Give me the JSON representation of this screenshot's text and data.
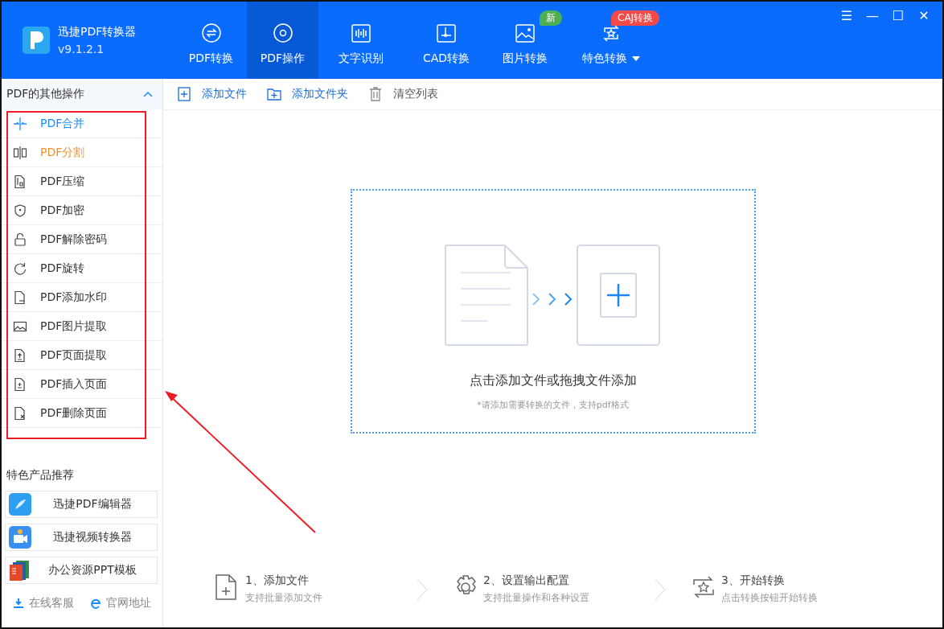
{
  "app": {
    "name": "迅捷PDF转换器",
    "version": "v9.1.2.1"
  },
  "tabs": [
    {
      "label": "PDF转换",
      "selected": false
    },
    {
      "label": "PDF操作",
      "selected": true
    },
    {
      "label": "文字识别",
      "selected": false
    },
    {
      "label": "CAD转换",
      "selected": false
    },
    {
      "label": "图片转换",
      "selected": false,
      "badge": {
        "text": "新",
        "color": "#4caf50"
      }
    },
    {
      "label": "特色转换",
      "selected": false,
      "dropdown": true,
      "badge": {
        "text": "CAJ转换",
        "color": "#f44a4a"
      }
    }
  ],
  "window_controls": [
    "☰",
    "—",
    "☐",
    "✕"
  ],
  "sidebar": {
    "title": "PDF的其他操作",
    "expanded": true,
    "items": [
      {
        "label": "PDF合并",
        "selected": true,
        "hovered": false
      },
      {
        "label": "PDF分割",
        "selected": false,
        "hovered": true
      },
      {
        "label": "PDF压缩",
        "selected": false,
        "hovered": false
      },
      {
        "label": "PDF加密",
        "selected": false,
        "hovered": false
      },
      {
        "label": "PDF解除密码",
        "selected": false,
        "hovered": false
      },
      {
        "label": "PDF旋转",
        "selected": false,
        "hovered": false
      },
      {
        "label": "PDF添加水印",
        "selected": false,
        "hovered": false
      },
      {
        "label": "PDF图片提取",
        "selected": false,
        "hovered": false
      },
      {
        "label": "PDF页面提取",
        "selected": false,
        "hovered": false
      },
      {
        "label": "PDF插入页面",
        "selected": false,
        "hovered": false
      },
      {
        "label": "PDF删除页面",
        "selected": false,
        "hovered": false
      }
    ],
    "recommend_title": "特色产品推荐",
    "products": [
      "迅捷PDF编辑器",
      "迅捷视频转换器",
      "办公资源PPT模板"
    ],
    "links": [
      "在线客服",
      "官网地址"
    ]
  },
  "toolbar": [
    "添加文件",
    "添加文件夹",
    "清空列表"
  ],
  "dropzone": {
    "title": "点击添加文件或拖拽文件添加",
    "hint": "*请添加需要转换的文件，支持pdf格式"
  },
  "steps": [
    {
      "title": "1、添加文件",
      "desc": "支持批量添加文件"
    },
    {
      "title": "2、设置输出配置",
      "desc": "支持批量操作和各种设置"
    },
    {
      "title": "3、开始转换",
      "desc": "点击转换按钮开始转换"
    }
  ],
  "annotations": {
    "highlight_box": true,
    "pointer_arrow": true
  }
}
